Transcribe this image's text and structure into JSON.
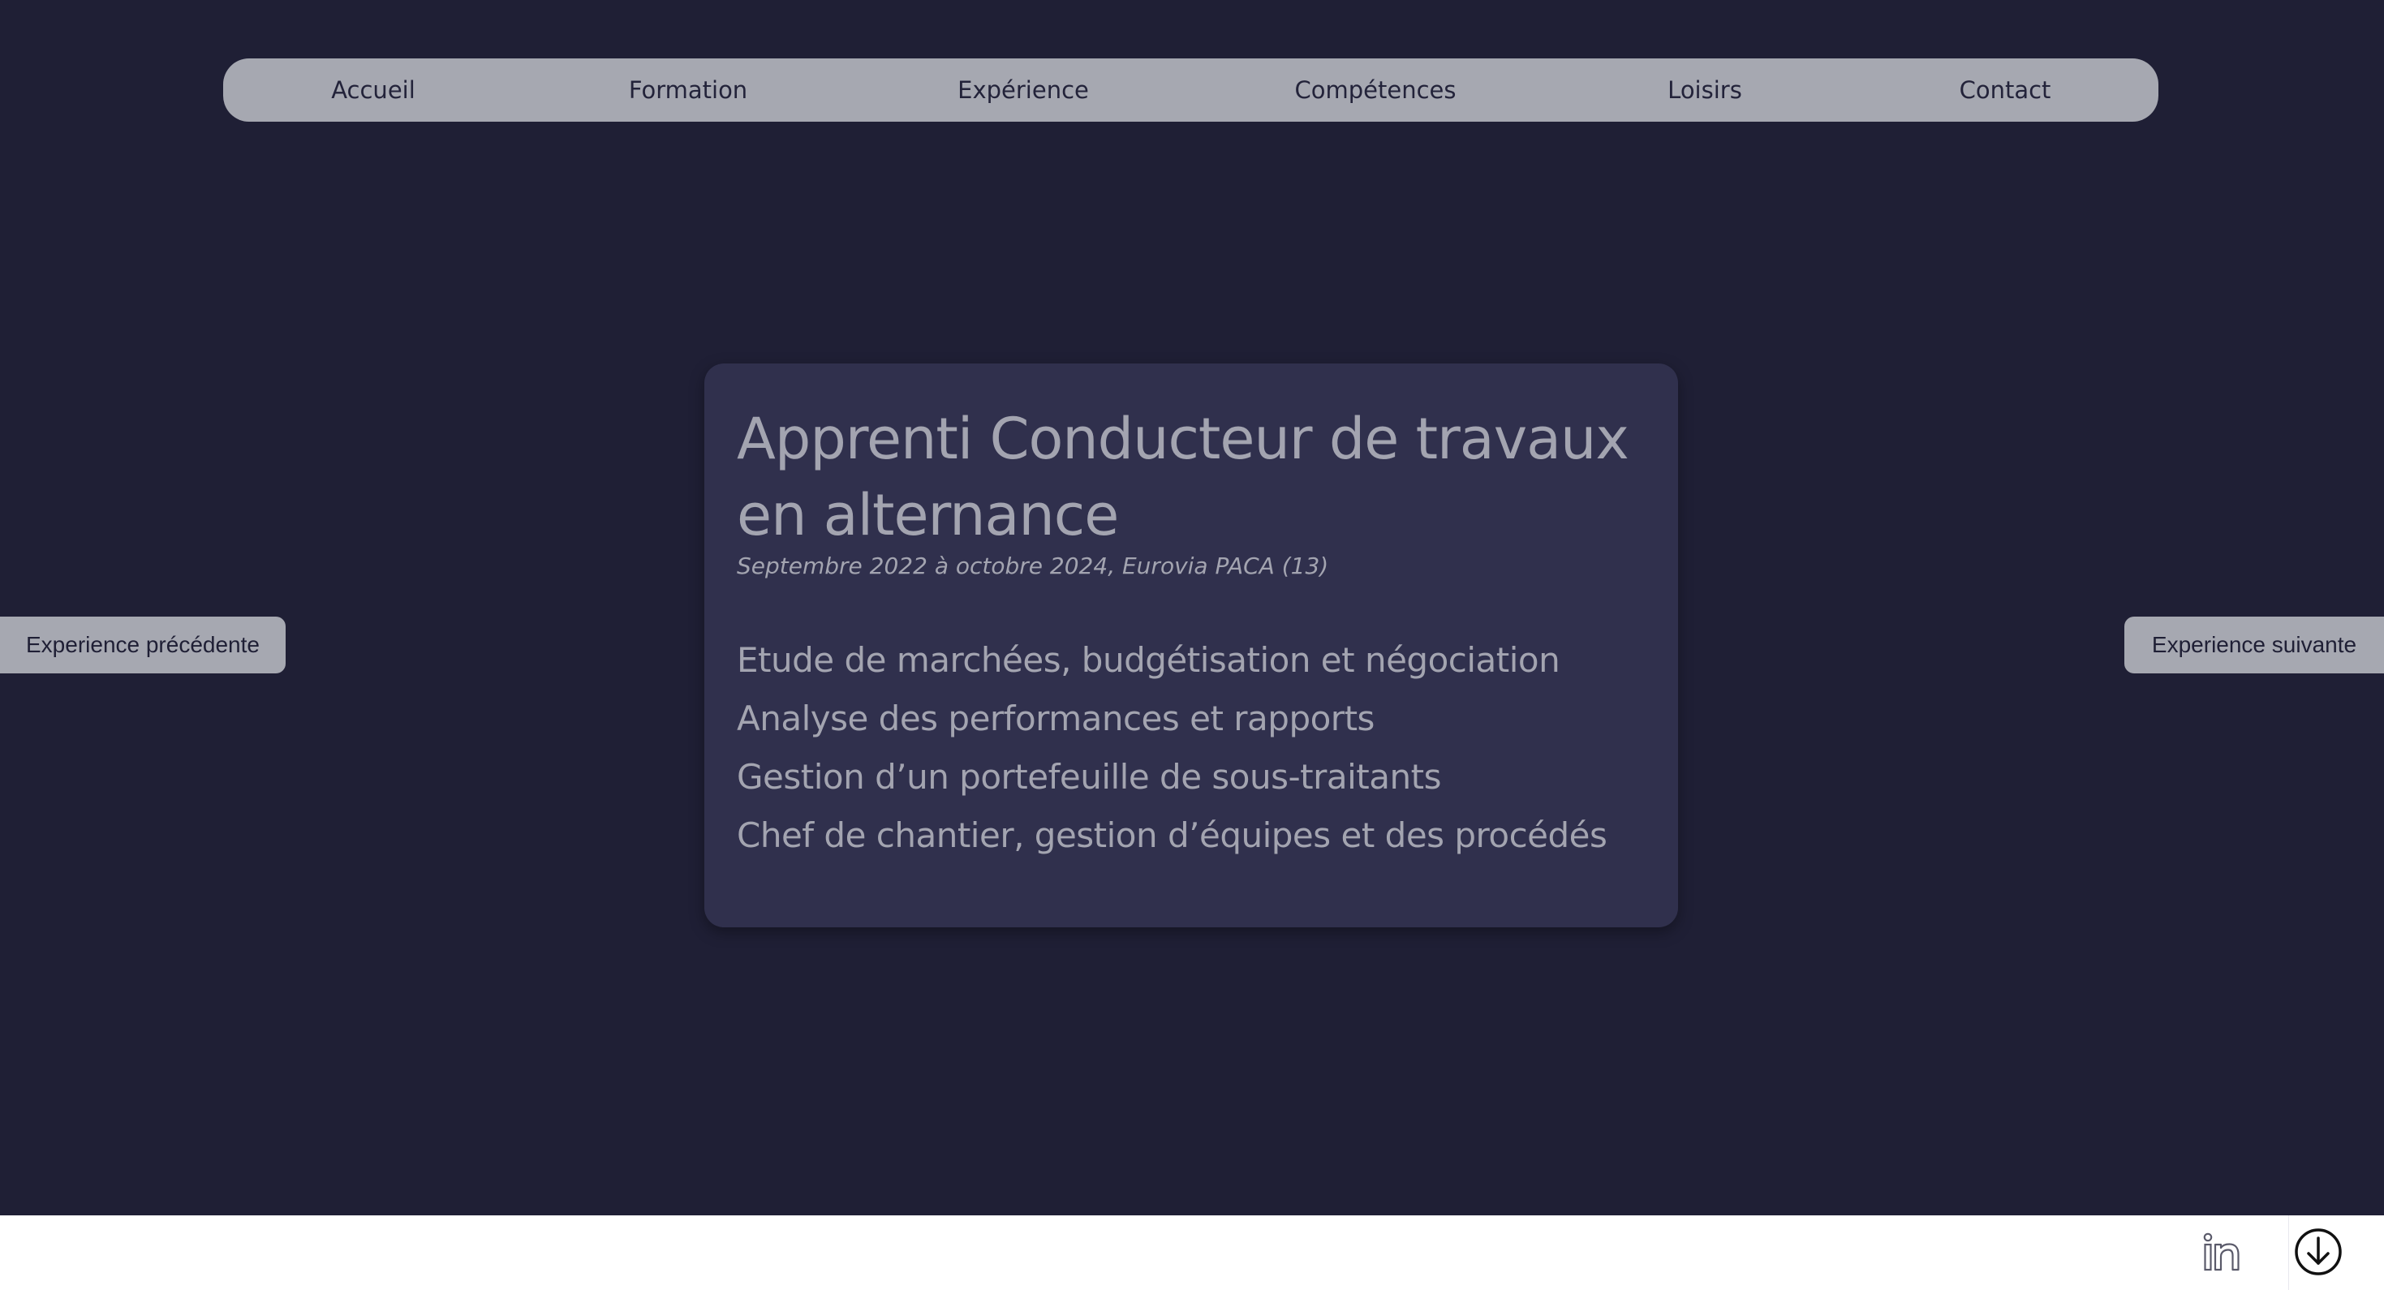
{
  "nav": {
    "items": [
      {
        "label": "Accueil"
      },
      {
        "label": "Formation"
      },
      {
        "label": "Expérience"
      },
      {
        "label": "Compétences"
      },
      {
        "label": "Loisirs"
      },
      {
        "label": "Contact"
      }
    ]
  },
  "experience": {
    "title": "Apprenti Conducteur de travaux en alternance",
    "subtitle": "Septembre 2022 à octobre 2024, Eurovia PACA (13)",
    "tasks": [
      "Etude de marchées, budgétisation et négociation",
      "Analyse des performances et rapports",
      "Gestion d’un portefeuille de sous-traitants",
      "Chef de chantier, gestion d’équipes et des procédés"
    ]
  },
  "buttons": {
    "prev_label": "Experience précédente",
    "next_label": "Experience suivante"
  },
  "footer": {
    "icons": [
      "linkedin-icon",
      "download-icon"
    ]
  },
  "colors": {
    "background": "#1f1f35",
    "card": "#30304d",
    "nav_bar": "#a6a8b1",
    "text_muted": "#a3a4b0",
    "footer": "#ffffff"
  }
}
